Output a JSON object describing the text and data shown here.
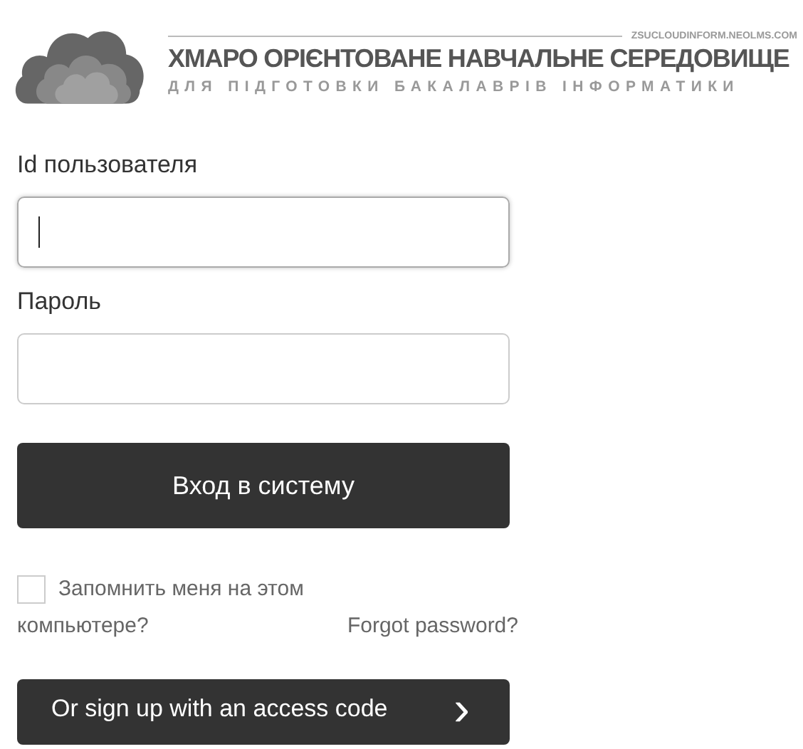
{
  "logo": {
    "site": "ZSUCLOUDINFORM.NEOLMS.COM",
    "title": "ХМАРО ОРІЄНТОВАНЕ НАВЧАЛЬНЕ СЕРЕДОВИЩЕ",
    "subtitle": "ДЛЯ ПІДГОТОВКИ БАКАЛАВРІВ ІНФОРМАТИКИ"
  },
  "fields": [
    {
      "label": "Id пользователя",
      "focused": true
    },
    {
      "label": "Пароль",
      "focused": false
    }
  ],
  "login_button": "Вход в систему",
  "remember": {
    "label_lines": [
      "Запомнить меня на этом",
      "компьютере?"
    ],
    "checked": false
  },
  "forgot_link": "Forgot password?",
  "signup_button": {
    "label": "Or sign up with an access code",
    "icon": "›"
  }
}
